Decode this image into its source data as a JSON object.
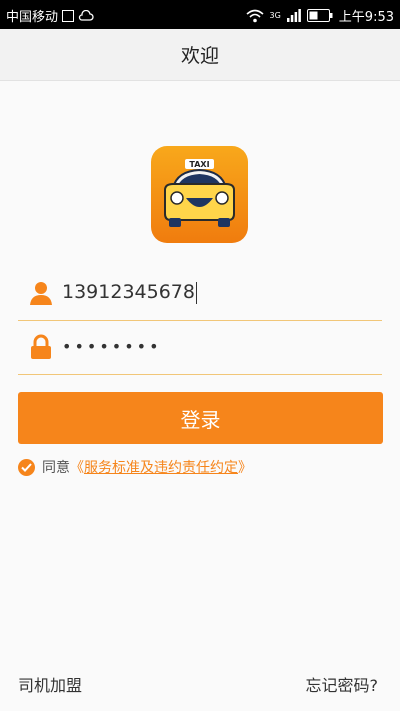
{
  "statusbar": {
    "carrier": "中国移动",
    "network": "3G",
    "time": "上午9:53"
  },
  "header": {
    "title": "欢迎"
  },
  "app_logo": {
    "sign_text": "TAXI",
    "icon": "taxi-logo-icon"
  },
  "form": {
    "phone": {
      "value": "13912345678",
      "icon": "user-icon"
    },
    "password": {
      "value": "••••••••",
      "icon": "lock-icon"
    }
  },
  "login_button": {
    "label": "登录"
  },
  "agreement": {
    "prefix": "同意",
    "open_bracket": "《",
    "link_text": "服务标准及违约责任约定",
    "close_bracket": "》"
  },
  "footer": {
    "driver_join": "司机加盟",
    "forgot_password": "忘记密码?"
  },
  "colors": {
    "accent": "#f6851b",
    "field_underline": "#f1c678",
    "logo_top": "#f8a81b",
    "logo_bottom": "#f07c0e"
  }
}
